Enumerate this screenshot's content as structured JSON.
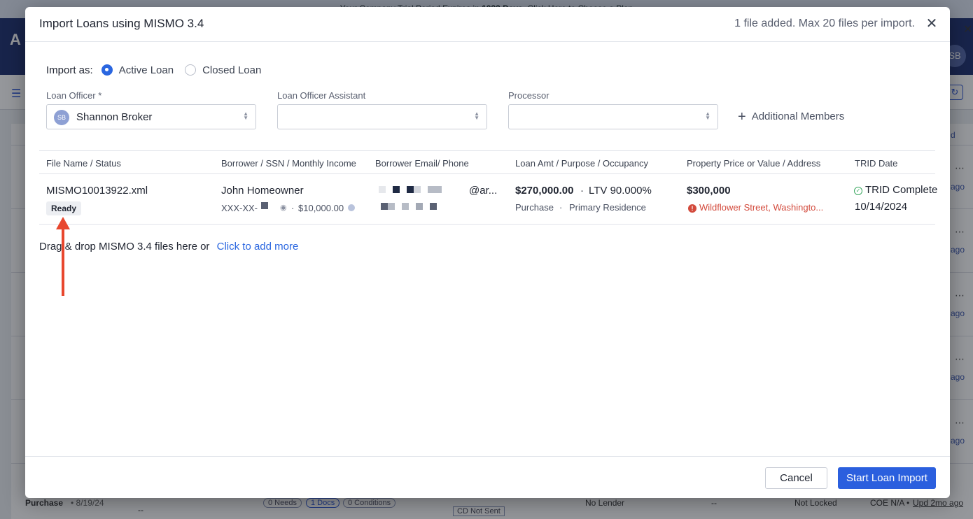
{
  "background": {
    "trial_banner_prefix": "Your Company Trial Period Expires in ",
    "trial_banner_days": "1033 Days",
    "trial_banner_suffix": ". Click Here to Choose a Plan",
    "logo_letter": "A",
    "avatar_initials": "SB",
    "side_texts": [
      "d",
      "ago",
      "ago",
      "ago",
      "ago",
      "ago"
    ],
    "bottom_row": {
      "type": "Purchase",
      "date": "• 8/19/24",
      "dash1": "--",
      "needs": "0 Needs",
      "docs": "1 Docs",
      "conditions": "0 Conditions",
      "cd": "CD Not Sent",
      "lender": "No Lender",
      "dash2": "--",
      "lock": "Not Locked",
      "coe": "COE N/A •",
      "updated": "Upd 2mo ago"
    }
  },
  "modal": {
    "title": "Import Loans using MISMO 3.4",
    "file_status": "1 file added. Max 20 files per import.",
    "import_as_label": "Import as:",
    "options": [
      {
        "label": "Active Loan",
        "selected": true
      },
      {
        "label": "Closed Loan",
        "selected": false
      }
    ],
    "fields": {
      "loan_officer_label": "Loan Officer *",
      "loan_officer_value": "Shannon Broker",
      "loan_officer_initials": "SB",
      "assistant_label": "Loan Officer Assistant",
      "processor_label": "Processor"
    },
    "additional_members": "Additional Members",
    "table": {
      "headers": [
        "File Name / Status",
        "Borrower / SSN / Monthly Income",
        "Borrower Email/ Phone",
        "Loan Amt / Purpose / Occupancy",
        "Property Price or Value / Address",
        "TRID Date"
      ],
      "row": {
        "file_name": "MISMO10013922.xml",
        "status": "Ready",
        "borrower": "John Homeowner",
        "ssn_prefix": "XXX-XX-",
        "income_sep": "·",
        "income": "$10,000.00",
        "email_suffix": "@ar...",
        "loan_amount": "$270,000.00",
        "ltv_sep": "·",
        "ltv": "LTV 90.000%",
        "purpose": "Purchase",
        "purpose_sep": "·",
        "occupancy": "Primary Residence",
        "property_value": "$300,000",
        "address": "Wildflower Street, Washingto...",
        "trid_status": "TRID Complete",
        "trid_date": "10/14/2024"
      }
    },
    "drop_text": "Drag & drop MISMO 3.4 files here or",
    "drop_link": "Click to add more",
    "cancel_label": "Cancel",
    "start_label": "Start Loan Import"
  },
  "colors": {
    "primary": "#2b5fde",
    "annotation_arrow": "#e8472e",
    "warning": "#d34a3c",
    "success": "#3aa860"
  }
}
